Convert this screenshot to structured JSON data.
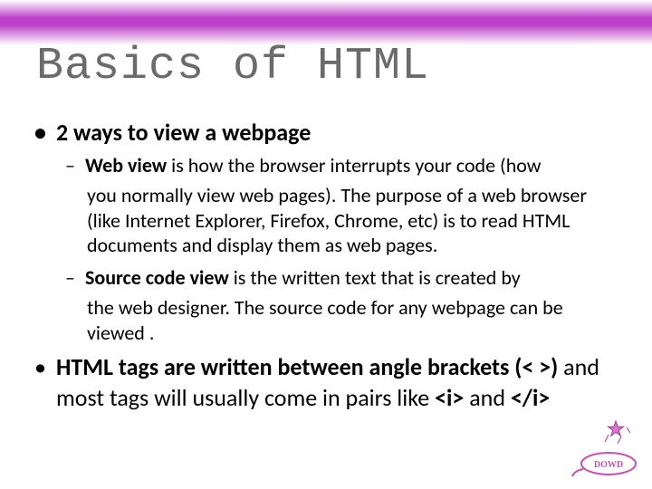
{
  "title": "Basics of HTML",
  "bullet1": "2 ways to view a webpage",
  "web_view": {
    "lead": "Web view",
    "tail": " is how the browser interrupts your code (how",
    "cont": "you normally view web pages).  The purpose of a web browser (like Internet Explorer, Firefox, Chrome, etc) is to read HTML documents and display them as web pages."
  },
  "source_view": {
    "lead": "Source code view",
    "tail": " is the written text that is created by",
    "cont": "the web designer. The source code for any webpage can be viewed ."
  },
  "tags": {
    "part1": "HTML tags are written between angle brackets (< >)",
    "part2": " and most tags will usually come in pairs like ",
    "part3": "<i>",
    "part4": " and ",
    "part5": "</i>"
  }
}
